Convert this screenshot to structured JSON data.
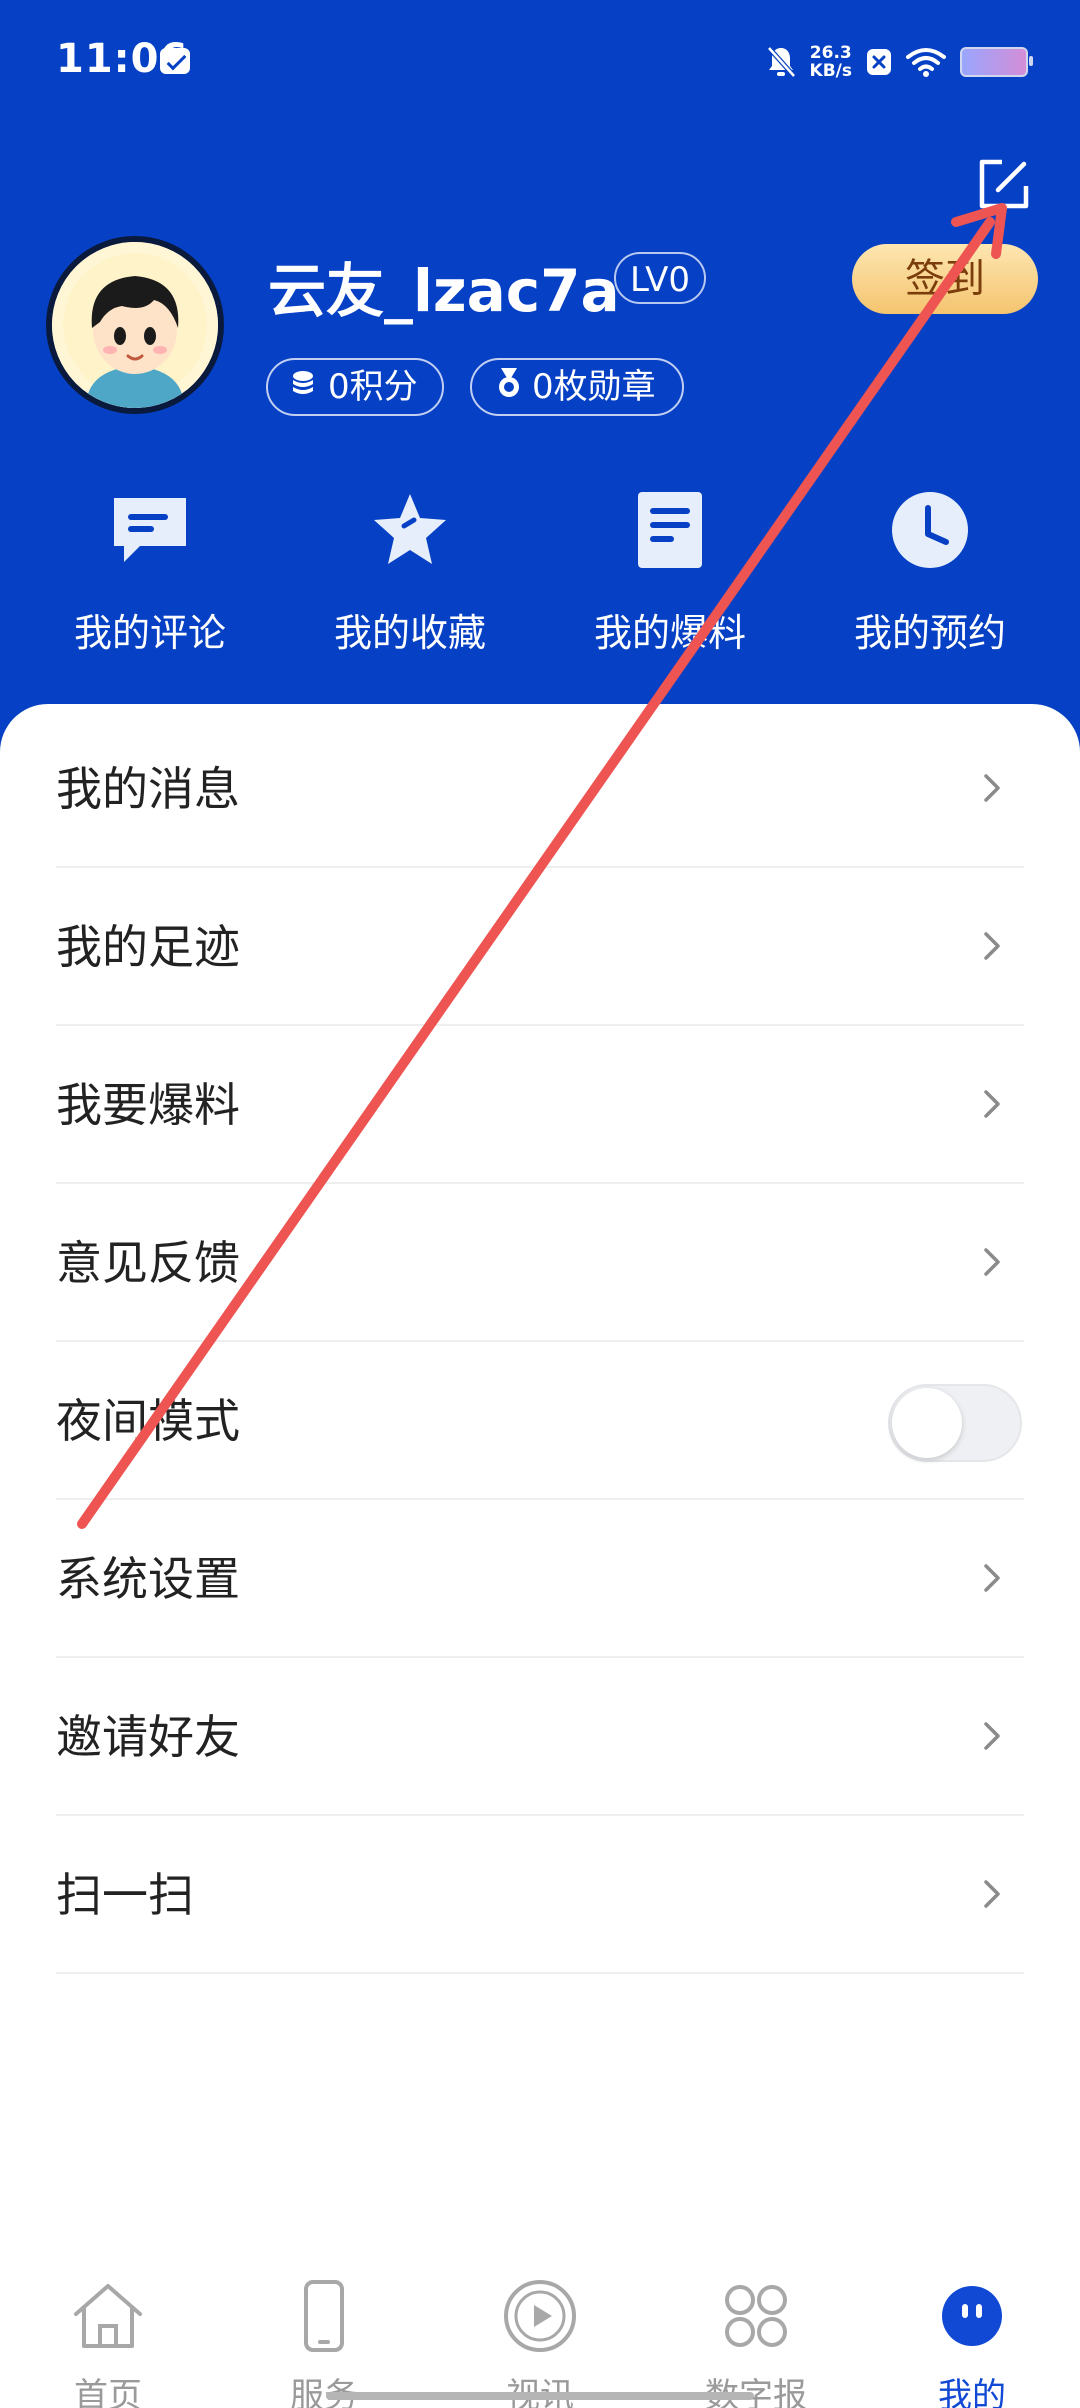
{
  "status_bar": {
    "time": "11:06",
    "net_speed_value": "26.3",
    "net_speed_unit": "KB/s",
    "icons": [
      "mail-icon",
      "mute-icon",
      "close-box-icon",
      "wifi-icon",
      "battery-icon"
    ]
  },
  "profile": {
    "username": "云友_lzac7a",
    "level": "LV0",
    "checkin_label": "签到",
    "points_label": "0积分",
    "medals_label": "0枚勋章"
  },
  "quick_actions": [
    {
      "label": "我的评论",
      "icon": "comment-icon"
    },
    {
      "label": "我的收藏",
      "icon": "star-icon"
    },
    {
      "label": "我的爆料",
      "icon": "document-icon"
    },
    {
      "label": "我的预约",
      "icon": "clock-icon"
    }
  ],
  "menu": [
    {
      "label": "我的消息"
    },
    {
      "label": "我的足迹"
    },
    {
      "label": "我要爆料"
    },
    {
      "label": "意见反馈"
    },
    {
      "label": "夜间模式",
      "toggle": false
    },
    {
      "label": "系统设置"
    },
    {
      "label": "邀请好友"
    },
    {
      "label": "扫一扫"
    }
  ],
  "bottom_nav": [
    {
      "label": "首页",
      "icon": "home-icon",
      "active": false
    },
    {
      "label": "服务",
      "icon": "phone-icon",
      "active": false
    },
    {
      "label": "视讯",
      "icon": "play-icon",
      "active": false
    },
    {
      "label": "数字报",
      "icon": "grid-icon",
      "active": false
    },
    {
      "label": "我的",
      "icon": "profile-face-icon",
      "active": true
    }
  ],
  "colors": {
    "header_blue": "#0640c4",
    "active_nav": "#1149d4",
    "checkin_gold": "#f5c46f",
    "annotation_red": "#ee5552"
  }
}
